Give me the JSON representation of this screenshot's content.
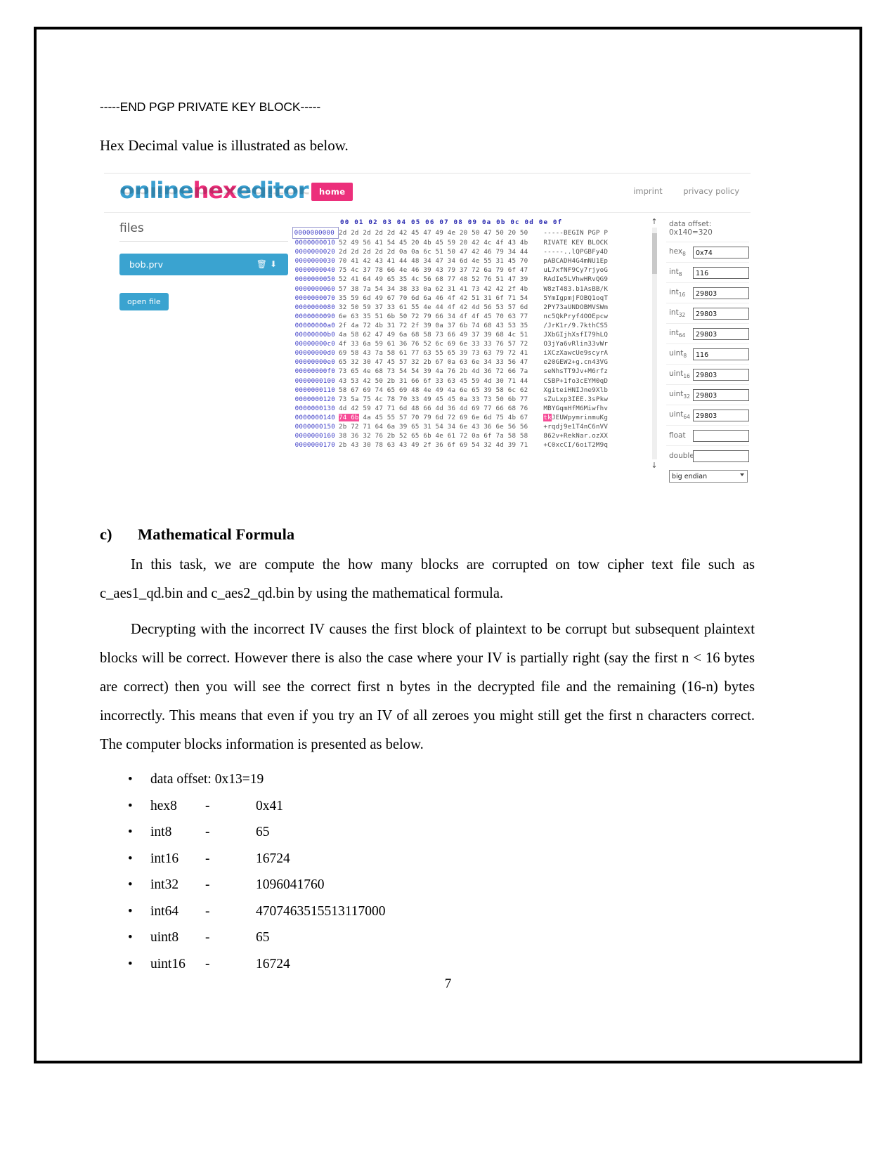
{
  "document": {
    "pgp_end_line": "-----END PGP PRIVATE KEY BLOCK-----",
    "lead_sentence": "Hex Decimal value is illustrated as below.",
    "page_number": "7"
  },
  "hex_editor": {
    "brand": {
      "part1": "online",
      "part2": "hex",
      "part3": "editor"
    },
    "home_button": "home",
    "nav": {
      "imprint": "imprint",
      "privacy": "privacy policy"
    },
    "files_panel": {
      "title": "files",
      "file_name": "bob.prv",
      "delete_icon": "trash-icon",
      "download_icon": "download-icon",
      "open_file_button": "open file"
    },
    "column_header": "00 01 02 03 04 05 06 07 08 09 0a 0b 0c 0d 0e 0f",
    "rows": [
      {
        "offset": "0000000000",
        "selected": true,
        "bytes": "2d 2d 2d 2d 2d 42 45 47 49 4e 20 50 47 50 20 50",
        "ascii": "-----BEGIN PGP P"
      },
      {
        "offset": "0000000010",
        "selected": false,
        "bytes": "52 49 56 41 54 45 20 4b 45 59 20 42 4c 4f 43 4b",
        "ascii": "RIVATE KEY BLOCK"
      },
      {
        "offset": "0000000020",
        "selected": false,
        "bytes": "2d 2d 2d 2d 2d 0a 0a 6c 51 50 47 42 46 79 34 44",
        "ascii": "-----..lQPGBFy4D"
      },
      {
        "offset": "0000000030",
        "selected": false,
        "bytes": "70 41 42 43 41 44 48 34 47 34 6d 4e 55 31 45 70",
        "ascii": "pABCADH4G4mNU1Ep"
      },
      {
        "offset": "0000000040",
        "selected": false,
        "bytes": "75 4c 37 78 66 4e 46 39 43 79 37 72 6a 79 6f 47",
        "ascii": "uL7xfNF9Cy7rjyoG"
      },
      {
        "offset": "0000000050",
        "selected": false,
        "bytes": "52 41 64 49 65 35 4c 56 68 77 48 52 76 51 47 39",
        "ascii": "RAdIe5LVhwHRvQG9"
      },
      {
        "offset": "0000000060",
        "selected": false,
        "bytes": "57 38 7a 54 34 38 33 0a 62 31 41 73 42 42 2f 4b",
        "ascii": "W8zT483.b1AsBB/K"
      },
      {
        "offset": "0000000070",
        "selected": false,
        "bytes": "35 59 6d 49 67 70 6d 6a 46 4f 42 51 31 6f 71 54",
        "ascii": "5YmIgpmjFOBQ1oqT"
      },
      {
        "offset": "0000000080",
        "selected": false,
        "bytes": "32 50 59 37 33 61 55 4e 44 4f 42 4d 56 53 57 6d",
        "ascii": "2PY73aUNDOBMVSWm"
      },
      {
        "offset": "0000000090",
        "selected": false,
        "bytes": "6e 63 35 51 6b 50 72 79 66 34 4f 4f 45 70 63 77",
        "ascii": "nc5QkPryf4OOEpcw"
      },
      {
        "offset": "00000000a0",
        "selected": false,
        "bytes": "2f 4a 72 4b 31 72 2f 39 0a 37 6b 74 68 43 53 35",
        "ascii": "/JrK1r/9.7kthCS5"
      },
      {
        "offset": "00000000b0",
        "selected": false,
        "bytes": "4a 58 62 47 49 6a 68 58 73 66 49 37 39 68 4c 51",
        "ascii": "JXbGIjhXsfI79hLQ"
      },
      {
        "offset": "00000000c0",
        "selected": false,
        "bytes": "4f 33 6a 59 61 36 76 52 6c 69 6e 33 33 76 57 72",
        "ascii": "O3jYa6vRlin33vWr"
      },
      {
        "offset": "00000000d0",
        "selected": false,
        "bytes": "69 58 43 7a 58 61 77 63 55 65 39 73 63 79 72 41",
        "ascii": "iXCzXawcUe9scyrA"
      },
      {
        "offset": "00000000e0",
        "selected": false,
        "bytes": "65 32 30 47 45 57 32 2b 67 0a 63 6e 34 33 56 47",
        "ascii": "e20GEW2+g.cn43VG"
      },
      {
        "offset": "00000000f0",
        "selected": false,
        "bytes": "73 65 4e 68 73 54 54 39 4a 76 2b 4d 36 72 66 7a",
        "ascii": "seNhsTT9Jv+M6rfz"
      },
      {
        "offset": "0000000100",
        "selected": false,
        "bytes": "43 53 42 50 2b 31 66 6f 33 63 45 59 4d 30 71 44",
        "ascii": "CSBP+1fo3cEYM0qD"
      },
      {
        "offset": "0000000110",
        "selected": false,
        "bytes": "58 67 69 74 65 69 48 4e 49 4a 6e 65 39 58 6c 62",
        "ascii": "XgiteiHNIJne9Xlb"
      },
      {
        "offset": "0000000120",
        "selected": false,
        "bytes": "73 5a 75 4c 78 70 33 49 45 45 0a 33 73 50 6b 77",
        "ascii": "sZuLxp3IEE.3sPkw"
      },
      {
        "offset": "0000000130",
        "selected": false,
        "bytes": "4d 42 59 47 71 6d 48 66 4d 36 4d 69 77 66 68 76",
        "ascii": "MBYGqmHfM6Miwfhv"
      },
      {
        "offset": "0000000140",
        "selected": false,
        "highlight_bytes": 2,
        "bytes": "74 6b 4a 45 55 57 70 79 6d 72 69 6e 6d 75 4b 67",
        "ascii": "tkJEUWpymrinmuKg"
      },
      {
        "offset": "0000000150",
        "selected": false,
        "bytes": "2b 72 71 64 6a 39 65 31 54 34 6e 43 36 6e 56 56",
        "ascii": "+rqdj9e1T4nC6nVV"
      },
      {
        "offset": "0000000160",
        "selected": false,
        "bytes": "38 36 32 76 2b 52 65 6b 4e 61 72 0a 6f 7a 58 58",
        "ascii": "862v+RekNar.ozXX"
      },
      {
        "offset": "0000000170",
        "selected": false,
        "bytes": "2b 43 30 78 63 43 49 2f 36 6f 69 54 32 4d 39 71",
        "ascii": "+C0xcCI/6oiT2M9q"
      }
    ],
    "inspector": {
      "data_offset": "data offset: 0x140=320",
      "fields": [
        {
          "label": "hex",
          "sub": "8",
          "value": "0x74"
        },
        {
          "label": "int",
          "sub": "8",
          "value": "116"
        },
        {
          "label": "int",
          "sub": "16",
          "value": "29803"
        },
        {
          "label": "int",
          "sub": "32",
          "value": "29803"
        },
        {
          "label": "int",
          "sub": "64",
          "value": "29803"
        },
        {
          "label": "uint",
          "sub": "8",
          "value": "116"
        },
        {
          "label": "uint",
          "sub": "16",
          "value": "29803"
        },
        {
          "label": "uint",
          "sub": "32",
          "value": "29803"
        },
        {
          "label": "uint",
          "sub": "64",
          "value": "29803"
        },
        {
          "label": "float",
          "sub": "",
          "value": ""
        },
        {
          "label": "double",
          "sub": "",
          "value": ""
        }
      ],
      "endian_select": "big endian"
    },
    "scroll": {
      "up_arrow": "arrow-up-icon",
      "down_arrow": "arrow-down-icon"
    }
  },
  "section": {
    "letter": "c)",
    "heading": "Mathematical Formula",
    "paragraph1": "In this task, we are compute the how many blocks are corrupted on tow cipher text file such as c_aes1_qd.bin and c_aes2_qd.bin by using the mathematical formula.",
    "paragraph2": "Decrypting with the incorrect IV causes the first block of plaintext to be corrupt but subsequent plaintext blocks will be correct. However there is also the case where your IV is partially right (say the first n < 16 bytes are correct) then you will see the correct first n bytes in the decrypted file and the remaining (16-n) bytes incorrectly. This means that even if you try an IV of all zeroes you might still get the first n characters correct. The computer blocks information is presented as below.",
    "facts": [
      {
        "key": "data offset: 0x13=19",
        "dash": "",
        "value": ""
      },
      {
        "key": "hex8",
        "dash": "-",
        "value": "0x41"
      },
      {
        "key": "int8",
        "dash": "-",
        "value": "65"
      },
      {
        "key": "int16",
        "dash": "-",
        "value": "16724"
      },
      {
        "key": "int32",
        "dash": "-",
        "value": "1096041760"
      },
      {
        "key": "int64",
        "dash": "-",
        "value": "4707463515513117000"
      },
      {
        "key": "uint8",
        "dash": "-",
        "value": "65"
      },
      {
        "key": "uint16",
        "dash": "-",
        "value": "16724"
      }
    ]
  }
}
